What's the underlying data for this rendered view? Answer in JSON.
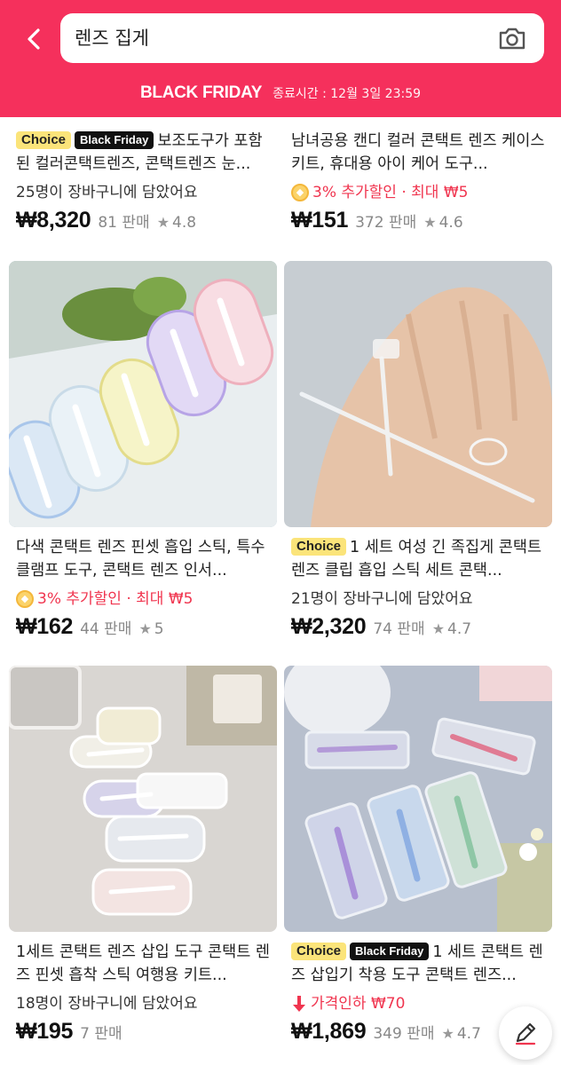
{
  "search": {
    "query": "렌즈 집게"
  },
  "promo": {
    "title": "BLACK FRIDAY",
    "deadline": "종료시간 : 12월 3일 23:59"
  },
  "badges": {
    "choice": "Choice",
    "black_friday": "Black Friday"
  },
  "products": [
    {
      "title": "보조도구가 포함된 컬러콘택트렌즈, 콘택트렌즈 눈...",
      "info": "25명이 장바구니에 담았어요",
      "price": "₩8,320",
      "sold": "81 판매",
      "rating": "4.8"
    },
    {
      "title": "남녀공용 캔디 컬러 콘택트 렌즈 케이스 키트, 휴대용 아이 케어 도구...",
      "info": "3% 추가할인 · 최대 ₩5",
      "price": "₩151",
      "sold": "372 판매",
      "rating": "4.6"
    },
    {
      "title": "다색 콘택트 렌즈 핀셋 흡입 스틱, 특수 클램프 도구, 콘택트 렌즈 인서...",
      "info": "3% 추가할인 · 최대 ₩5",
      "price": "₩162",
      "sold": "44 판매",
      "rating": "5"
    },
    {
      "title": "1 세트 여성 긴 족집게 콘택트 렌즈 클립 흡입 스틱 세트 콘택...",
      "info": "21명이 장바구니에 담았어요",
      "price": "₩2,320",
      "sold": "74 판매",
      "rating": "4.7"
    },
    {
      "title": "1세트 콘택트 렌즈 삽입 도구 콘택트 렌즈 핀셋 흡착 스틱 여행용 키트...",
      "info": "18명이 장바구니에 담았어요",
      "price": "₩195",
      "sold": "7 판매",
      "rating": ""
    },
    {
      "title": "1 세트 콘택트 렌즈 삽입기 착용 도구 콘택트 렌즈...",
      "info": "가격인하 ₩70",
      "price": "₩1,869",
      "sold": "349 판매",
      "rating": "4.7"
    }
  ],
  "colors": {
    "brand": "#f5305c",
    "discount": "#f0354f",
    "choice_badge": "#fbe47a"
  },
  "icons": [
    "back-arrow-icon",
    "camera-icon",
    "coin-icon",
    "star-icon",
    "price-drop-icon",
    "edit-icon"
  ]
}
